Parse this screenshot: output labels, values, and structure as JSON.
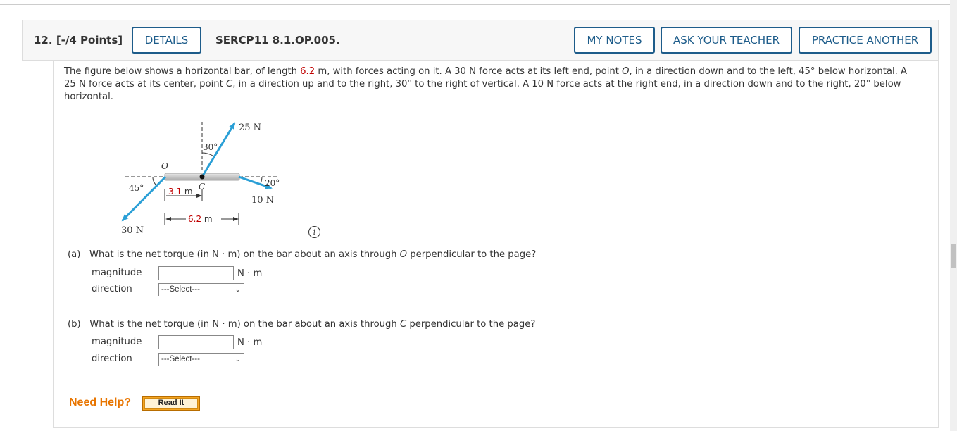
{
  "header": {
    "question_number": "12.",
    "points": "[-/4 Points]",
    "details_label": "DETAILS",
    "problem_code": "SERCP11 8.1.OP.005.",
    "my_notes_label": "MY NOTES",
    "ask_teacher_label": "ASK YOUR TEACHER",
    "practice_label": "PRACTICE ANOTHER"
  },
  "question": {
    "t1": "The figure below shows a horizontal bar, of length ",
    "length": "6.2",
    "t2": " m, with forces acting on it. A 30 N force acts at its left end, point ",
    "point_o": "O",
    "t3": ", in a direction down and to the left, 45° below horizontal. A 25 N force acts at its center, point ",
    "point_c": "C",
    "t4": ", in a direction up and to the right, 30° to the right of vertical. A 10 N force acts at the right end, in a direction down and to the right, 20° below horizontal."
  },
  "figure": {
    "f25": "25 N",
    "a30": "30°",
    "o_label": "O",
    "a45": "45°",
    "half_length": "3.1",
    "unit_m": " m",
    "c_label": "C",
    "a20": "20°",
    "f10": "10 N",
    "full_length": "6.2",
    "unit_m2": " m",
    "f30": "30 N"
  },
  "part_a": {
    "letter": "(a)",
    "q1": "What is the net torque (in N · m) on the bar about an axis through ",
    "axis": "O",
    "q2": " perpendicular to the page?",
    "magnitude_label": "magnitude",
    "magnitude_value": "",
    "unit": "N · m",
    "direction_label": "direction",
    "direction_selected": "---Select---"
  },
  "part_b": {
    "letter": "(b)",
    "q1": "What is the net torque (in N · m) on the bar about an axis through ",
    "axis": "C",
    "q2": " perpendicular to the page?",
    "magnitude_label": "magnitude",
    "magnitude_value": "",
    "unit": "N · m",
    "direction_label": "direction",
    "direction_selected": "---Select---"
  },
  "help": {
    "need_help": "Need Help?",
    "read_it": "Read It"
  },
  "colors": {
    "accent": "#1d5c8a",
    "arrow": "#2a9fd6",
    "highlight": "#c00000",
    "help": "#e87500"
  }
}
